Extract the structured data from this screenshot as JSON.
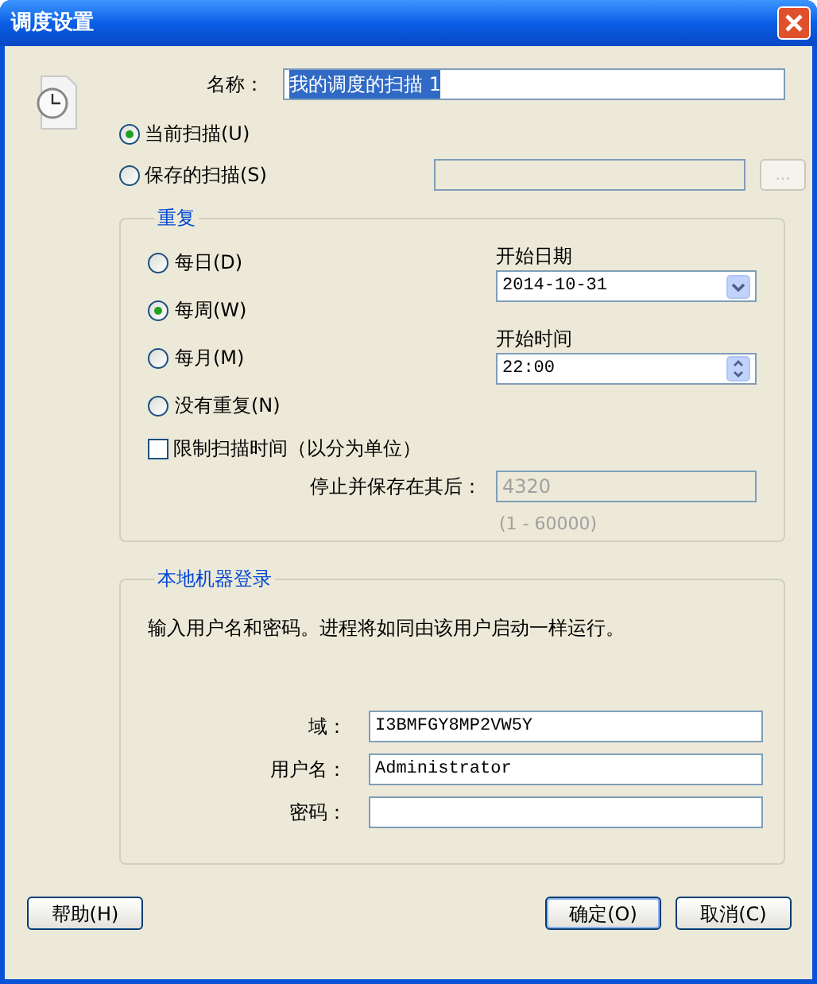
{
  "window": {
    "title": "调度设置"
  },
  "name_field": {
    "label": "名称：",
    "value": "我的调度的扫描 1",
    "highlighted": true
  },
  "scan_source": [
    {
      "label": "当前扫描(U)",
      "selected": true
    },
    {
      "label": "保存的扫描(S)",
      "selected": false
    }
  ],
  "saved_scan_field": {
    "disabled": true
  },
  "browse_button": {
    "label": "...",
    "disabled": true
  },
  "repeat": {
    "title": "重复",
    "options": [
      {
        "label": "每日(D)",
        "selected": false
      },
      {
        "label": "每周(W)",
        "selected": true
      },
      {
        "label": "每月(M)",
        "selected": false
      },
      {
        "label": "没有重复(N)",
        "selected": false
      }
    ],
    "start_date": {
      "label": "开始日期",
      "value": "2014-10-31"
    },
    "start_time": {
      "label": "开始时间",
      "value": "22:00"
    },
    "limit": {
      "label": "限制扫描时间（以分为单位）",
      "checked": false
    },
    "stop_after": {
      "label": "停止并保存在其后：",
      "value": "4320",
      "disabled": true
    },
    "range_hint": "(1 - 60000)"
  },
  "login": {
    "title": "本地机器登录",
    "description": "输入用户名和密码。进程将如同由该用户启动一样运行。",
    "fields": [
      {
        "label": "域：",
        "value": "I3BMFGY8MP2VW5Y"
      },
      {
        "label": "用户名：",
        "value": "Administrator"
      },
      {
        "label": "密码："
      }
    ]
  },
  "buttons": [
    {
      "label": "帮助(H)",
      "default": false
    },
    {
      "label": "确定(O)",
      "default": true
    },
    {
      "label": "取消(C)",
      "default": false
    }
  ]
}
